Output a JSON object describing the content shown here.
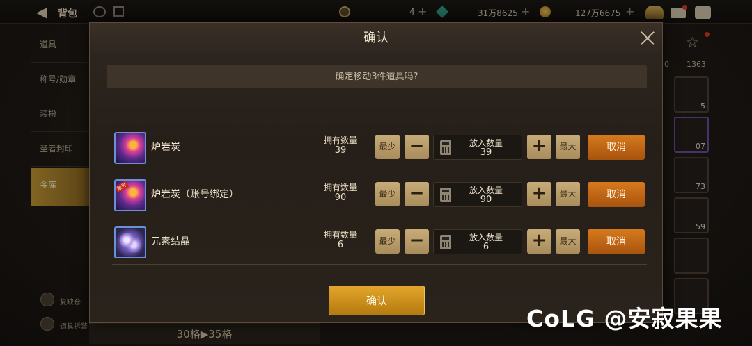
{
  "topbar": {
    "title": "背包",
    "currencies": [
      {
        "name": "c-coin-icon",
        "value": "4",
        "color": "#c9a75a"
      },
      {
        "name": "gem-icon",
        "value": "31万8625",
        "color": "#3fc4a4"
      },
      {
        "name": "gold-coin-icon",
        "value": "127万6675",
        "color": "#e0b040"
      }
    ]
  },
  "sidebar": {
    "items": [
      "道具",
      "称号/勋章",
      "装扮",
      "圣者封印",
      "金库"
    ],
    "bottom_items": [
      "复缺仓",
      "道具拆装"
    ],
    "capacity": "30格▶35格"
  },
  "right_panel": {
    "counts": [
      "0",
      "1363"
    ],
    "slot_numbers": [
      "5",
      "07",
      "73",
      "59"
    ]
  },
  "dialog": {
    "title": "确认",
    "prompt": "确定移动3件道具吗?",
    "own_label": "拥有数量",
    "put_label": "放入数量",
    "min_label": "最少",
    "max_label": "最大",
    "minus_symbol": "−",
    "plus_symbol": "+",
    "cancel_label": "取消",
    "items": [
      {
        "name": "炉岩炭",
        "owned": "39",
        "put": "39",
        "icon": "lava-charcoal-icon"
      },
      {
        "name": "炉岩炭（账号绑定）",
        "owned": "90",
        "put": "90",
        "icon": "lava-charcoal-bound-icon",
        "badge": "账号"
      },
      {
        "name": "元素结晶",
        "owned": "6",
        "put": "6",
        "icon": "element-crystal-icon"
      }
    ],
    "confirm_label": "确认"
  },
  "watermark": "CoLG @安寂果果"
}
